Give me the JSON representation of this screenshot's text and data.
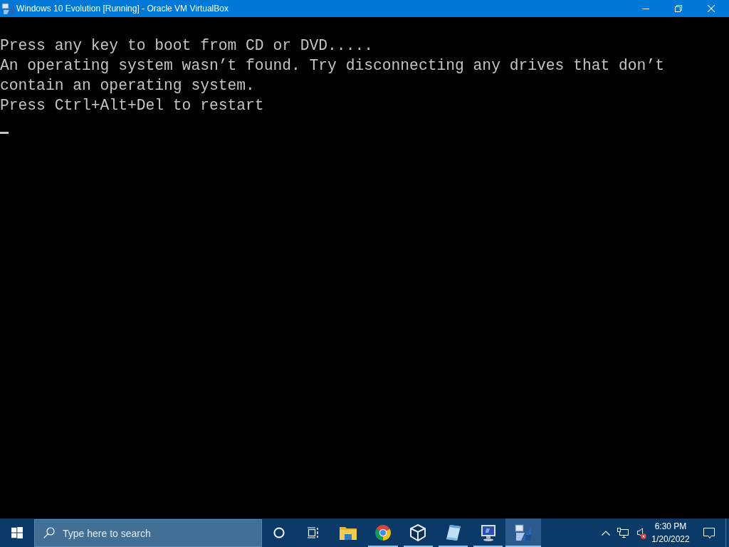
{
  "window": {
    "title": "Windows 10 Evolution [Running] - Oracle VM VirtualBox"
  },
  "console": {
    "lines": [
      "Press any key to boot from CD or DVD.....",
      "An operating system wasn’t found. Try disconnecting any drives that don’t",
      "contain an operating system.",
      "Press Ctrl+Alt+Del to restart"
    ],
    "cursor": true
  },
  "taskbar": {
    "search": {
      "placeholder": "Type here to search"
    },
    "apps": [
      {
        "kind": "folder",
        "running": false,
        "selected": false
      },
      {
        "kind": "browser",
        "running": true,
        "selected": false
      },
      {
        "kind": "cube",
        "running": true,
        "selected": false
      },
      {
        "kind": "notepad",
        "running": true,
        "selected": false
      },
      {
        "kind": "monitor",
        "running": true,
        "selected": false
      },
      {
        "kind": "vm",
        "running": true,
        "selected": true
      }
    ],
    "tray": {
      "volume_muted": true
    },
    "clock": {
      "time": "6:30 PM",
      "date": "1/20/2022"
    }
  }
}
